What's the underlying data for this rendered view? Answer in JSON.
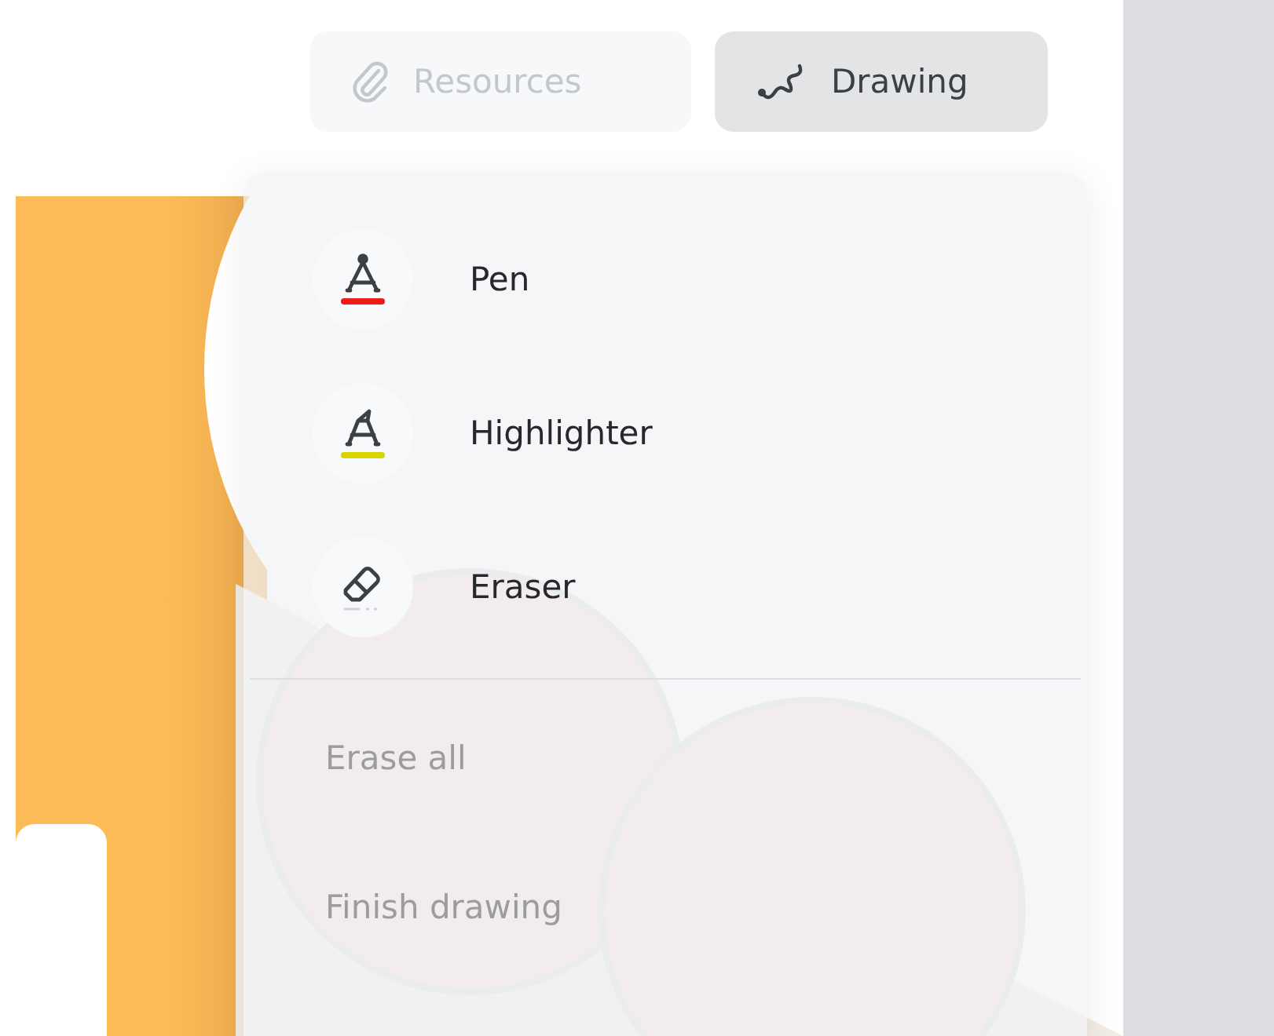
{
  "toolbar": [
    {
      "label": "Resources",
      "kind": "attach",
      "disabled": true,
      "selected": false
    },
    {
      "label": "Drawing",
      "kind": "draw",
      "disabled": false,
      "selected": true
    }
  ],
  "drawing_menu": {
    "tools": [
      {
        "label": "Pen",
        "kind": "pen",
        "color": "#ee1c1c"
      },
      {
        "label": "Highlighter",
        "kind": "highlighter",
        "color": "#d9d400"
      },
      {
        "label": "Eraser",
        "kind": "eraser"
      }
    ],
    "actions": [
      {
        "label": "Erase all",
        "disabled": true
      },
      {
        "label": "Finish drawing",
        "disabled": true
      }
    ]
  }
}
